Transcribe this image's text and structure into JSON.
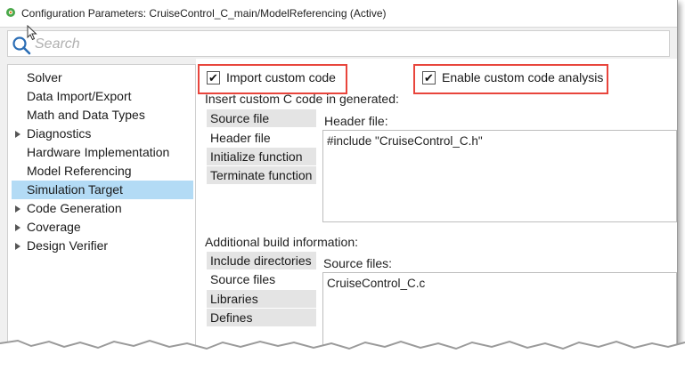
{
  "window": {
    "title": "Configuration Parameters: CruiseControl_C_main/ModelReferencing (Active)"
  },
  "search": {
    "placeholder": "Search"
  },
  "sidebar": {
    "items": [
      {
        "label": "Solver",
        "expandable": false,
        "selected": false
      },
      {
        "label": "Data Import/Export",
        "expandable": false,
        "selected": false
      },
      {
        "label": "Math and Data Types",
        "expandable": false,
        "selected": false
      },
      {
        "label": "Diagnostics",
        "expandable": true,
        "selected": false
      },
      {
        "label": "Hardware Implementation",
        "expandable": false,
        "selected": false
      },
      {
        "label": "Model Referencing",
        "expandable": false,
        "selected": false
      },
      {
        "label": "Simulation Target",
        "expandable": false,
        "selected": true
      },
      {
        "label": "Code Generation",
        "expandable": true,
        "selected": false
      },
      {
        "label": "Coverage",
        "expandable": true,
        "selected": false
      },
      {
        "label": "Design Verifier",
        "expandable": true,
        "selected": false
      }
    ]
  },
  "options": {
    "import_custom_code": {
      "label": "Import custom code",
      "checked": true
    },
    "enable_analysis": {
      "label": "Enable custom code analysis",
      "checked": true
    },
    "check_glyph": "✔"
  },
  "custom_code": {
    "section_label": "Insert custom C code in generated:",
    "tabs": [
      "Source file",
      "Header file",
      "Initialize function",
      "Terminate function"
    ],
    "active_tab": "Header file",
    "field_label": "Header file:",
    "value": "#include \"CruiseControl_C.h\""
  },
  "build_info": {
    "section_label": "Additional build information:",
    "tabs": [
      "Include directories",
      "Source files",
      "Libraries",
      "Defines"
    ],
    "active_tab": "Source files",
    "field_label": "Source files:",
    "value": "CruiseControl_C.c"
  },
  "colors": {
    "highlight_box": "#e8453c",
    "selected_item": "#b3dbf5"
  }
}
